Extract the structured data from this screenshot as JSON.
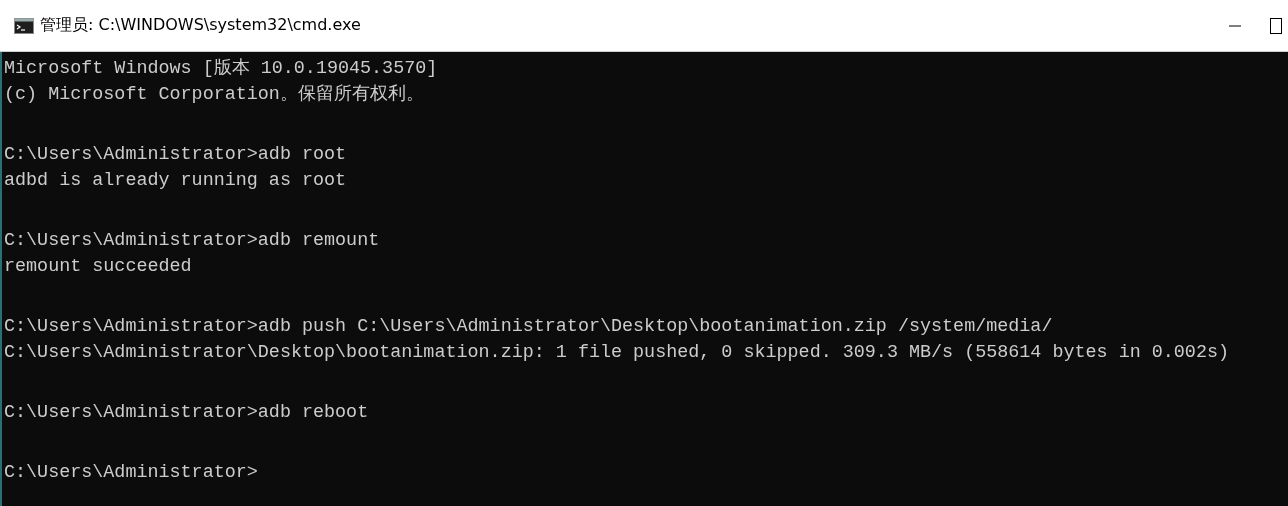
{
  "window": {
    "title": "管理员: C:\\WINDOWS\\system32\\cmd.exe"
  },
  "console": {
    "blocks": [
      [
        "Microsoft Windows [版本 10.0.19045.3570]",
        "(c) Microsoft Corporation。保留所有权利。"
      ],
      [
        "C:\\Users\\Administrator>adb root",
        "adbd is already running as root"
      ],
      [
        "C:\\Users\\Administrator>adb remount",
        "remount succeeded"
      ],
      [
        "C:\\Users\\Administrator>adb push C:\\Users\\Administrator\\Desktop\\bootanimation.zip /system/media/",
        "C:\\Users\\Administrator\\Desktop\\bootanimation.zip: 1 file pushed, 0 skipped. 309.3 MB/s (558614 bytes in 0.002s)"
      ],
      [
        "C:\\Users\\Administrator>adb reboot"
      ],
      [
        "C:\\Users\\Administrator>"
      ]
    ]
  }
}
